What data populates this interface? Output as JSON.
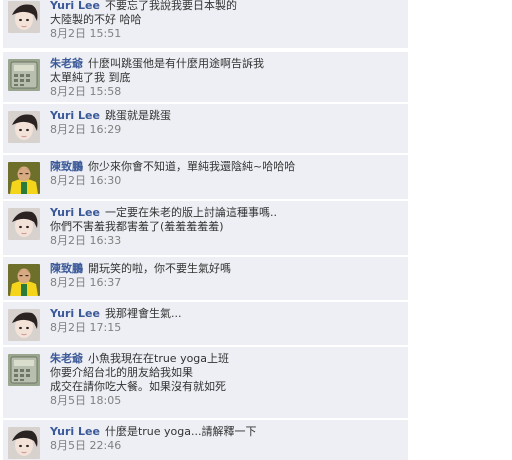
{
  "comments": [
    {
      "author": "Yuri Lee",
      "avatar": "girl-avatar",
      "lines": [
        "不要忘了我說我要日本製的",
        "大陸製的不好 哈哈"
      ],
      "time": "8月2日 15:51"
    },
    {
      "author": "朱老爺",
      "avatar": "calculator-avatar",
      "lines": [
        "什麼叫跳蛋他是有什麼用途啊告訴我",
        "太單純了我 到底"
      ],
      "time": "8月2日 15:58"
    },
    {
      "author": "Yuri Lee",
      "avatar": "girl-avatar",
      "lines": [
        "跳蛋就是跳蛋"
      ],
      "time": "8月2日 16:29"
    },
    {
      "author": "陳致鵬",
      "avatar": "yellow-jersey-avatar",
      "lines": [
        "你少來你會不知道，單純我還陰純~哈哈哈"
      ],
      "time": "8月2日 16:30"
    },
    {
      "author": "Yuri Lee",
      "avatar": "girl-avatar",
      "lines": [
        "一定要在朱老的版上討論這種事嗎..",
        "你們不害羞我都害羞了(羞羞羞羞羞)"
      ],
      "time": "8月2日 16:33"
    },
    {
      "author": "陳致鵬",
      "avatar": "yellow-jersey-avatar",
      "lines": [
        "開玩笑的啦，你不要生氣好嗎"
      ],
      "time": "8月2日 16:37"
    },
    {
      "author": "Yuri Lee",
      "avatar": "girl-avatar",
      "lines": [
        "我那裡會生氣..."
      ],
      "time": "8月2日 17:15"
    },
    {
      "author": "朱老爺",
      "avatar": "calculator-avatar",
      "lines": [
        "小魚我現在在true yoga上班",
        "你要介紹台北的朋友給我如果",
        "成交在請你吃大餐。如果沒有就如死"
      ],
      "time": "8月5日 18:05"
    },
    {
      "author": "Yuri Lee",
      "avatar": "girl-avatar",
      "lines": [
        "什麼是true yoga...請解釋一下"
      ],
      "time": "8月5日 22:46"
    }
  ]
}
